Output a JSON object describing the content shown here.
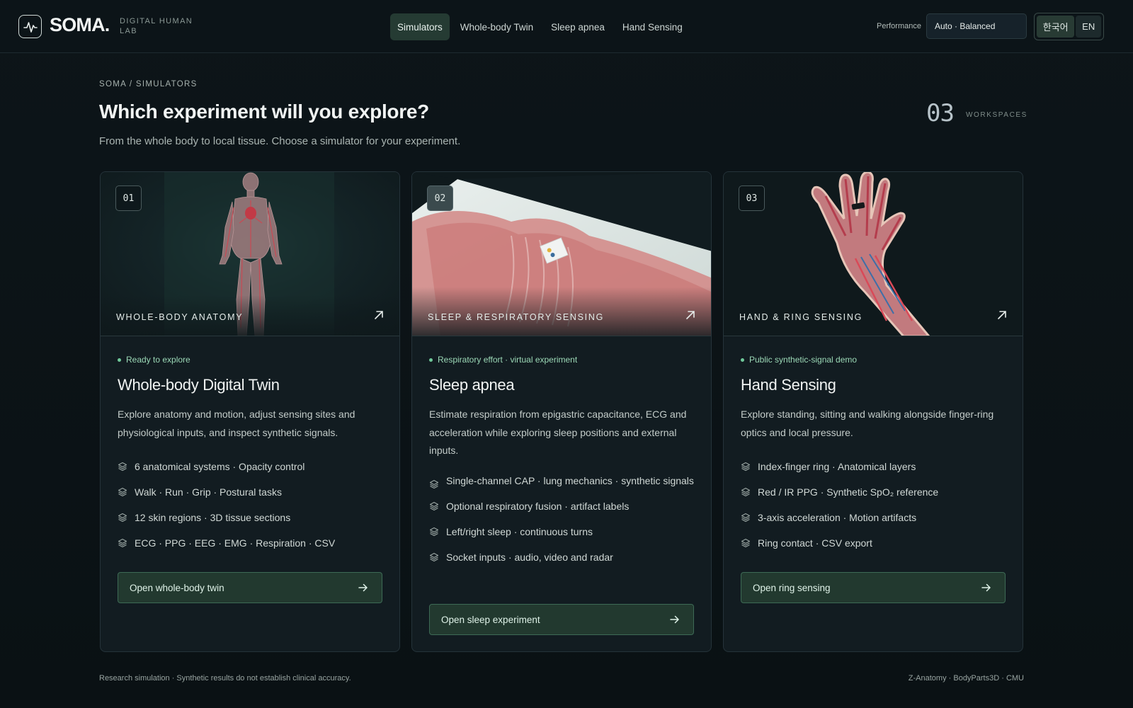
{
  "header": {
    "brand": "SOMA.",
    "brand_sub": "DIGITAL HUMAN LAB",
    "nav": [
      {
        "label": "Simulators",
        "active": true
      },
      {
        "label": "Whole-body Twin",
        "active": false
      },
      {
        "label": "Sleep apnea",
        "active": false
      },
      {
        "label": "Hand Sensing",
        "active": false
      }
    ],
    "performance_label": "Performance",
    "performance_value": "Auto · Balanced",
    "languages": [
      "한국어",
      "EN"
    ],
    "active_language": "한국어"
  },
  "page": {
    "breadcrumb": "SOMA / SIMULATORS",
    "title": "Which experiment will you explore?",
    "subtitle": "From the whole body to local tissue. Choose a simulator for your experiment.",
    "workspace_count": "03",
    "workspace_label": "WORKSPACES"
  },
  "cards": [
    {
      "number": "01",
      "tag": "WHOLE-BODY ANATOMY",
      "status": "Ready to explore",
      "title": "Whole-body Digital Twin",
      "description": "Explore anatomy and motion, adjust sensing sites and physiological inputs, and inspect synthetic signals.",
      "features": [
        "6 anatomical systems · Opacity control",
        "Walk · Run · Grip · Postural tasks",
        "12 skin regions · 3D tissue sections",
        "ECG · PPG · EEG · EMG · Respiration · CSV"
      ],
      "button": "Open whole-body twin"
    },
    {
      "number": "02",
      "tag": "SLEEP & RESPIRATORY SENSING",
      "status": "Respiratory effort · virtual experiment",
      "title": "Sleep apnea",
      "description": "Estimate respiration from epigastric capacitance, ECG and acceleration while exploring sleep positions and external inputs.",
      "features": [
        "Single-channel CAP · lung mechanics · synthetic signals",
        "Optional respiratory fusion · artifact labels",
        "Left/right sleep · continuous turns",
        "Socket inputs · audio, video and radar"
      ],
      "button": "Open sleep experiment"
    },
    {
      "number": "03",
      "tag": "HAND & RING SENSING",
      "status": "Public synthetic-signal demo",
      "title": "Hand Sensing",
      "description": "Explore standing, sitting and walking alongside finger-ring optics and local pressure.",
      "features": [
        "Index-finger ring · Anatomical layers",
        "Red / IR PPG · Synthetic SpO₂ reference",
        "3-axis acceleration · Motion artifacts",
        "Ring contact · CSV export"
      ],
      "button": "Open ring sensing"
    }
  ],
  "footer": {
    "disclaimer": "Research simulation · Synthetic results do not establish clinical accuracy.",
    "credits": "Z-Anatomy · BodyParts3D · CMU"
  },
  "icons": {
    "logo": "pulse-icon",
    "feature": "layers-icon",
    "card_link": "arrow-up-right-icon",
    "button": "arrow-right-icon"
  },
  "colors": {
    "background": "#0b1216",
    "accent": "#22392f",
    "status_green": "#6fc99a"
  }
}
